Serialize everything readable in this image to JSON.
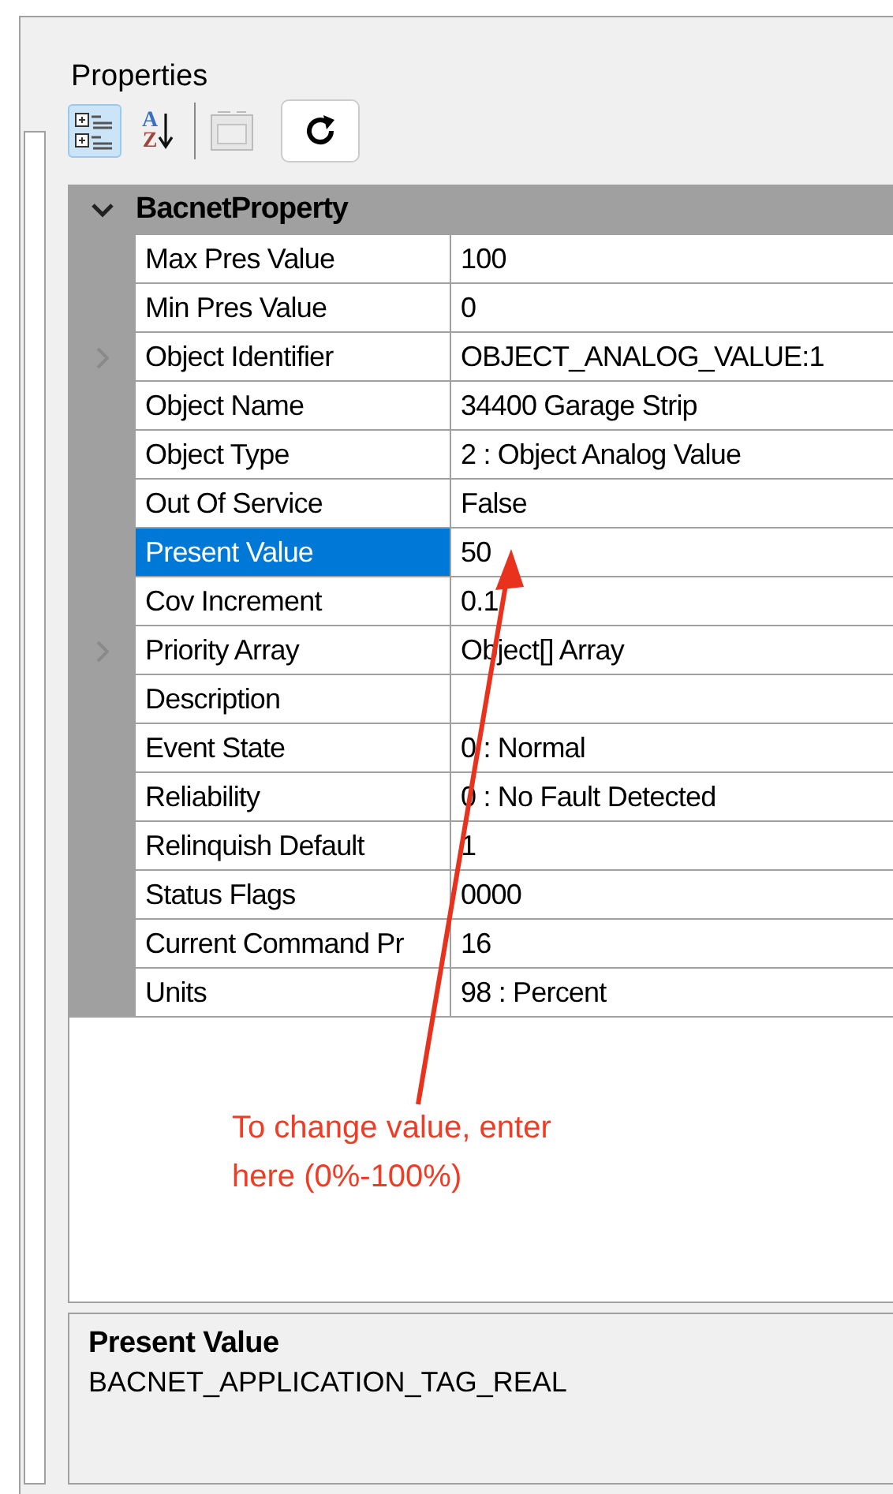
{
  "panel": {
    "title": "Properties"
  },
  "toolbar": [
    {
      "kind": "categorized",
      "selected": true
    },
    {
      "kind": "alphabetical",
      "selected": false,
      "letters": [
        "A",
        "Z"
      ]
    },
    {
      "kind": "property-pages",
      "disabled": true
    },
    {
      "kind": "refresh"
    }
  ],
  "category": {
    "name": "BacnetProperty",
    "expanded": true
  },
  "rows": [
    {
      "name": "Max Pres Value",
      "value": "100",
      "expandable": false,
      "selected": false
    },
    {
      "name": "Min Pres Value",
      "value": "0",
      "expandable": false,
      "selected": false
    },
    {
      "name": "Object Identifier",
      "value": "OBJECT_ANALOG_VALUE:1",
      "expandable": true,
      "selected": false
    },
    {
      "name": "Object Name",
      "value": "34400 Garage Strip",
      "expandable": false,
      "selected": false
    },
    {
      "name": "Object Type",
      "value": "2 : Object Analog Value",
      "expandable": false,
      "selected": false
    },
    {
      "name": "Out Of Service",
      "value": "False",
      "expandable": false,
      "selected": false
    },
    {
      "name": "Present Value",
      "value": "50",
      "expandable": false,
      "selected": true
    },
    {
      "name": "Cov Increment",
      "value": "0.1",
      "expandable": false,
      "selected": false
    },
    {
      "name": "Priority Array",
      "value": "Object[] Array",
      "expandable": true,
      "selected": false
    },
    {
      "name": "Description",
      "expandable": false,
      "selected": false
    },
    {
      "name": "Event State",
      "value": "0 : Normal",
      "expandable": false,
      "selected": false
    },
    {
      "name": "Reliability",
      "value": "0 : No Fault Detected",
      "expandable": false,
      "selected": false
    },
    {
      "name": "Relinquish Default",
      "value": "1",
      "expandable": false,
      "selected": false
    },
    {
      "name": "Status Flags",
      "value": "0000",
      "expandable": false,
      "selected": false
    },
    {
      "name": "Current Command Pr",
      "value": "16",
      "expandable": false,
      "selected": false
    },
    {
      "name": "Units",
      "value": "98 : Percent",
      "expandable": false,
      "selected": false
    }
  ],
  "annotation": {
    "text": "To change value, enter here (0%-100%)"
  },
  "description_panel": {
    "title": "Present Value",
    "text": "BACNET_APPLICATION_TAG_REAL"
  }
}
